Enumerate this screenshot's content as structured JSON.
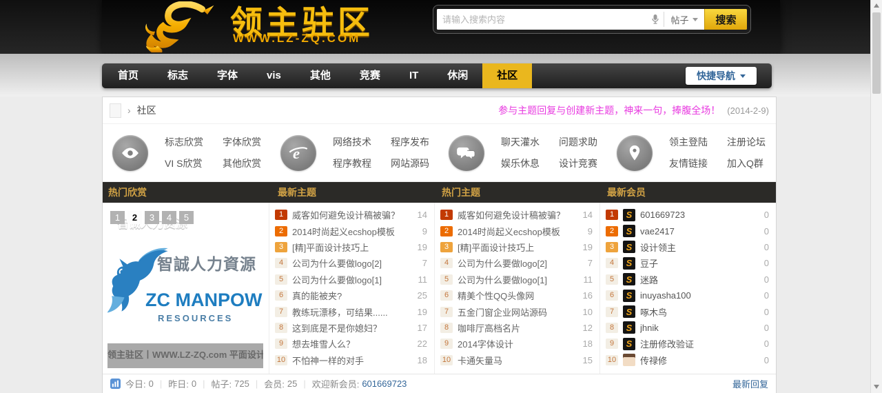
{
  "header": {
    "site_title": "领主驻区",
    "site_url": "WWW.LZ-ZQ.COM"
  },
  "search": {
    "placeholder": "请输入搜索内容",
    "scope": "帖子",
    "button": "搜索"
  },
  "nav": {
    "items": [
      "首页",
      "标志",
      "字体",
      "vis",
      "其他",
      "竞赛",
      "IT",
      "休闲",
      "社区"
    ],
    "active_index": 8,
    "quick_nav": "快捷导航"
  },
  "breadcrumb": {
    "current": "社区",
    "notice": "参与主题回复与创建新主题，神来一句，捧腹全场！",
    "date": "(2014-2-9)"
  },
  "categories": [
    {
      "icon": "eye-icon",
      "links": [
        "标志欣赏",
        "字体欣赏",
        "VI S欣赏",
        "其他欣赏"
      ]
    },
    {
      "icon": "ie-browser-icon",
      "links": [
        "网络技术",
        "程序发布",
        "程序教程",
        "网站源码"
      ]
    },
    {
      "icon": "chat-bubbles-icon",
      "links": [
        "聊天灌水",
        "问题求助",
        "娱乐休息",
        "设计竞赛"
      ]
    },
    {
      "icon": "location-pin-icon",
      "links": [
        "领主登陆",
        "注册论坛",
        "友情链接",
        "加入Q群"
      ]
    }
  ],
  "sections": {
    "col1": "热门欣赏",
    "col2": "最新主题",
    "col3": "热门主题",
    "col4": "最新会员"
  },
  "slider": {
    "pages": [
      "1",
      "2",
      "3",
      "4",
      "5"
    ],
    "active_page_index": 1,
    "brand_cn": "智誠人力資源",
    "brand_en": "ZC MANPOWER",
    "brand_sub": "RESOURCES",
    "watermark": "领主驻区丨WWW.LZ-ZQ.com 平面设计资源共享平台",
    "caption": "智诚人力资源"
  },
  "latest_topics": [
    {
      "rank": 1,
      "title": "威客如何避免设计稿被骗？",
      "count": 14
    },
    {
      "rank": 2,
      "title": "2014时尚起义ecshop模板",
      "count": 9
    },
    {
      "rank": 3,
      "title": "[精]平面设计技巧上",
      "count": 19
    },
    {
      "rank": 4,
      "title": "公司为什么要做logo[2]",
      "count": 7
    },
    {
      "rank": 5,
      "title": "公司为什么要做logo[1]",
      "count": 11
    },
    {
      "rank": 6,
      "title": "真的能被夹?",
      "count": 25
    },
    {
      "rank": 7,
      "title": "教练玩漂移，可结果......",
      "count": 19
    },
    {
      "rank": 8,
      "title": "这到底是不是你媳妇？",
      "count": 17
    },
    {
      "rank": 9,
      "title": "想去堆雪人么？",
      "count": 22
    },
    {
      "rank": 10,
      "title": "不怕神一样的对手",
      "count": 18
    }
  ],
  "hot_topics": [
    {
      "rank": 1,
      "title": "威客如何避免设计稿被骗？",
      "count": 14
    },
    {
      "rank": 2,
      "title": "2014时尚起义ecshop模板",
      "count": 9
    },
    {
      "rank": 3,
      "title": "[精]平面设计技巧上",
      "count": 19
    },
    {
      "rank": 4,
      "title": "公司为什么要做logo[2]",
      "count": 7
    },
    {
      "rank": 5,
      "title": "公司为什么要做logo[1]",
      "count": 11
    },
    {
      "rank": 6,
      "title": "精美个性QQ头像网",
      "count": 16
    },
    {
      "rank": 7,
      "title": "五金门窗企业网站源码",
      "count": 10
    },
    {
      "rank": 8,
      "title": "咖啡厅高档名片",
      "count": 12
    },
    {
      "rank": 9,
      "title": "2014字体设计",
      "count": 18
    },
    {
      "rank": 10,
      "title": "卡通矢量马",
      "count": 15
    }
  ],
  "new_members": [
    {
      "rank": 1,
      "name": "601669723",
      "count": 0,
      "avatar": "dragon"
    },
    {
      "rank": 2,
      "name": "vae2417",
      "count": 0,
      "avatar": "dragon"
    },
    {
      "rank": 3,
      "name": "设计领主",
      "count": 0,
      "avatar": "dragon"
    },
    {
      "rank": 4,
      "name": "豆子",
      "count": 0,
      "avatar": "dragon"
    },
    {
      "rank": 5,
      "name": "迷路",
      "count": 0,
      "avatar": "dragon"
    },
    {
      "rank": 6,
      "name": "inuyasha100",
      "count": 0,
      "avatar": "dragon"
    },
    {
      "rank": 7,
      "name": "啄木鸟",
      "count": 0,
      "avatar": "dragon"
    },
    {
      "rank": 8,
      "name": "jhnik",
      "count": 0,
      "avatar": "dragon"
    },
    {
      "rank": 9,
      "name": "注册修改验证",
      "count": 0,
      "avatar": "dragon"
    },
    {
      "rank": 10,
      "name": "传禄修",
      "count": 0,
      "avatar": "person"
    }
  ],
  "footer": {
    "stats": [
      {
        "label": "今日:",
        "value": "0"
      },
      {
        "label": "昨日:",
        "value": "0"
      },
      {
        "label": "帖子:",
        "value": "725"
      },
      {
        "label": "会员:",
        "value": "25"
      },
      {
        "label": "欢迎新会员:",
        "value": "601669723",
        "link": true
      }
    ],
    "latest_reply": "最新回复"
  },
  "colors": {
    "accent_gold": "#eab71e",
    "notice_pink": "#e83be0",
    "link_blue": "#336699",
    "badge_rank1": "#c23a02",
    "badge_rank2": "#ec6c02",
    "badge_rank3": "#eea33c"
  }
}
